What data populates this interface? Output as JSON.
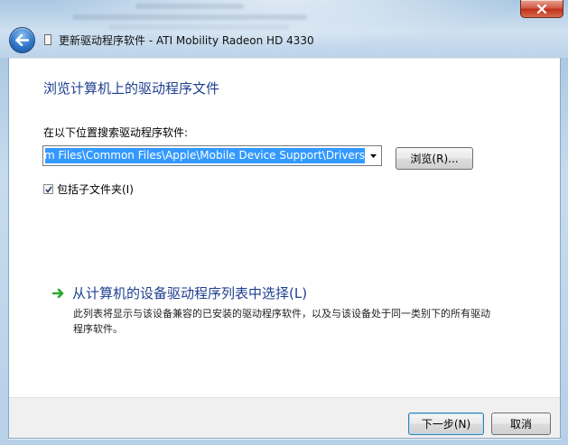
{
  "window": {
    "title": "更新驱动程序软件 - ATI Mobility Radeon HD 4330"
  },
  "main": {
    "heading": "浏览计算机上的驱动程序文件",
    "search_label": "在以下位置搜索驱动程序软件:",
    "path_value": "m Files\\Common Files\\Apple\\Mobile Device Support\\Drivers",
    "browse_label": "浏览(R)...",
    "include_subfolders": {
      "label": "包括子文件夹(I)",
      "checked": true
    },
    "pick_from_list": {
      "title": "从计算机的设备驱动程序列表中选择(L)",
      "description": "此列表将显示与该设备兼容的已安装的驱动程序软件，以及与该设备处于同一类别下的所有驱动程序软件。"
    }
  },
  "footer": {
    "next_label": "下一步(N)",
    "cancel_label": "取消"
  },
  "icons": {
    "back": "back-arrow-icon",
    "close": "close-icon",
    "dropdown": "chevron-down-icon",
    "link": "green-arrow-icon",
    "check": "check-icon"
  },
  "colors": {
    "heading": "#1e3f8f",
    "selection": "#3399ff",
    "link_arrow": "#2da82d",
    "close_red": "#c1311a"
  }
}
